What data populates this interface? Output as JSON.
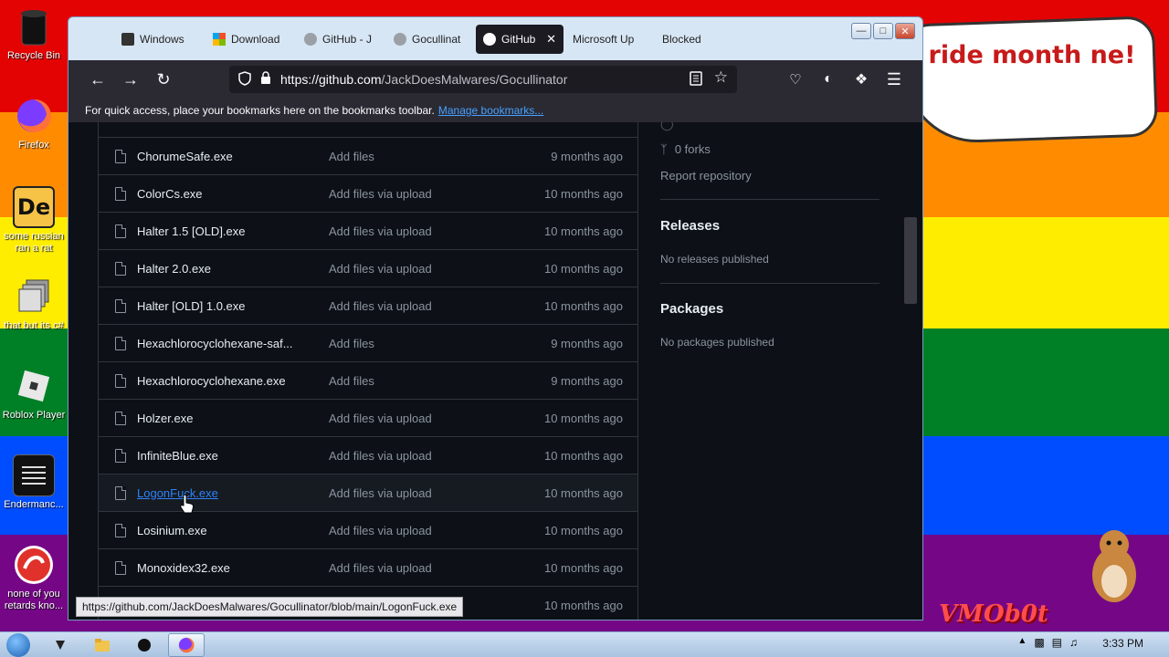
{
  "desktop": {
    "speech_text": "ride month ne!",
    "watermark": "VMOb0t",
    "icons": [
      {
        "label": "Recycle Bin",
        "icon": "recycle-bin-icon"
      },
      {
        "label": "Firefox",
        "icon": "firefox-icon"
      },
      {
        "label": "some russian ran a rat",
        "icon": "de-app-icon"
      },
      {
        "label": "that but its c#",
        "icon": "stack-icon"
      },
      {
        "label": "Roblox Player",
        "icon": "roblox-icon"
      },
      {
        "label": "Endermanc...",
        "icon": "terminal-icon"
      },
      {
        "label": "none of you retards kno...",
        "icon": "red-app-icon"
      }
    ]
  },
  "browser": {
    "tabs": [
      {
        "label": "Windows",
        "icon": "windows-icon",
        "active": false
      },
      {
        "label": "Download",
        "icon": "microsoft-icon",
        "active": false
      },
      {
        "label": "GitHub - J",
        "icon": "github-icon",
        "active": false
      },
      {
        "label": "Gocullinat",
        "icon": "github-icon",
        "active": false
      },
      {
        "label": "GitHub",
        "icon": "github-icon",
        "active": true
      },
      {
        "label": "Microsoft Up",
        "icon": "",
        "active": false
      },
      {
        "label": "Blocked",
        "icon": "",
        "active": false
      }
    ],
    "url_host": "https://github.com",
    "url_path": "/JackDoesMalwares/Gocullinator",
    "bookmarks_text": "For quick access, place your bookmarks here on the bookmarks toolbar.",
    "bookmarks_link": "Manage bookmarks...",
    "status_link": "https://github.com/JackDoesMalwares/Gocullinator/blob/main/LogonFuck.exe"
  },
  "files": [
    {
      "name": "ChorumeSafe.exe",
      "message": "Add files",
      "age": "9 months ago"
    },
    {
      "name": "ColorCs.exe",
      "message": "Add files via upload",
      "age": "10 months ago"
    },
    {
      "name": "Halter 1.5 [OLD].exe",
      "message": "Add files via upload",
      "age": "10 months ago"
    },
    {
      "name": "Halter 2.0.exe",
      "message": "Add files via upload",
      "age": "10 months ago"
    },
    {
      "name": "Halter [OLD] 1.0.exe",
      "message": "Add files via upload",
      "age": "10 months ago"
    },
    {
      "name": "Hexachlorocyclohexane-saf...",
      "message": "Add files",
      "age": "9 months ago"
    },
    {
      "name": "Hexachlorocyclohexane.exe",
      "message": "Add files",
      "age": "9 months ago"
    },
    {
      "name": "Holzer.exe",
      "message": "Add files via upload",
      "age": "10 months ago"
    },
    {
      "name": "InfiniteBlue.exe",
      "message": "Add files via upload",
      "age": "10 months ago"
    },
    {
      "name": "LogonFuck.exe",
      "message": "Add files via upload",
      "age": "10 months ago"
    },
    {
      "name": "Losinium.exe",
      "message": "Add files via upload",
      "age": "10 months ago"
    },
    {
      "name": "Monoxidex32.exe",
      "message": "Add files via upload",
      "age": "10 months ago"
    },
    {
      "name": "",
      "message": "",
      "age": "10 months ago"
    }
  ],
  "sidebar": {
    "forks": "0 forks",
    "report": "Report repository",
    "releases_title": "Releases",
    "releases_text": "No releases published",
    "packages_title": "Packages",
    "packages_text": "No packages published"
  },
  "taskbar": {
    "clock": "3:33 PM"
  }
}
